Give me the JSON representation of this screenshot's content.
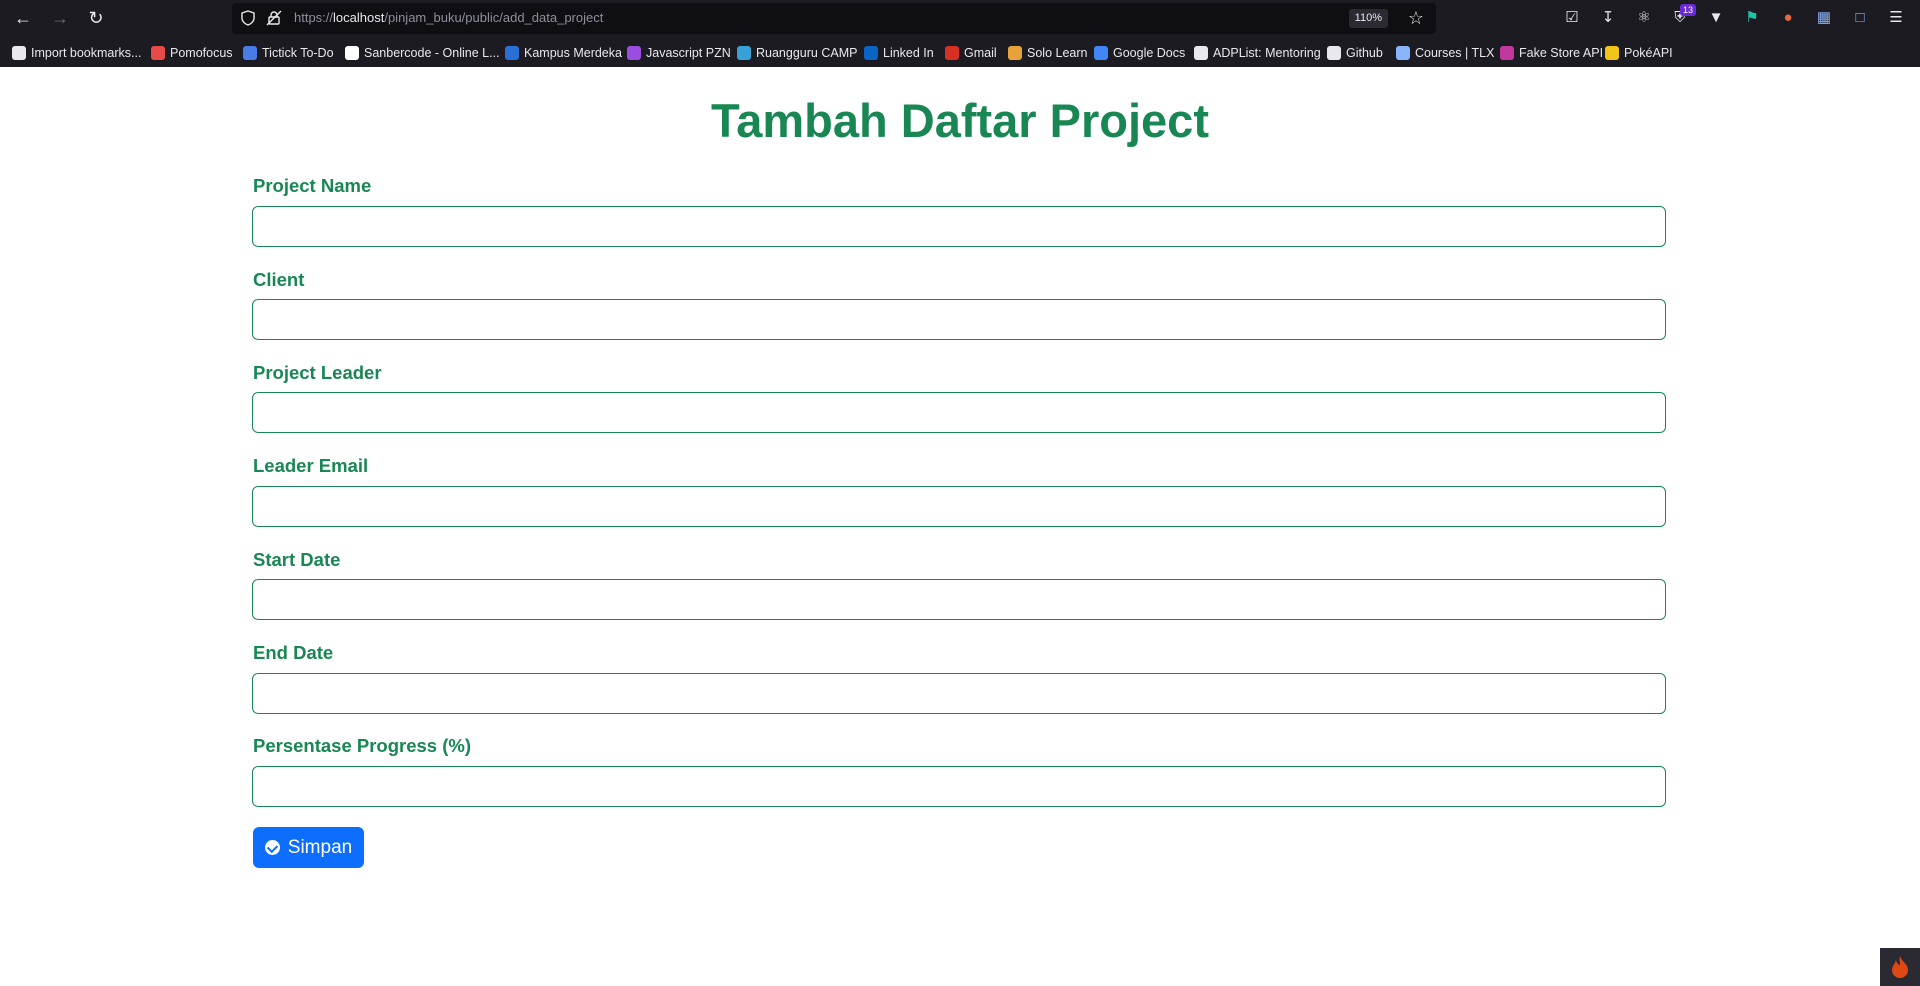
{
  "browser": {
    "url_host": "localhost",
    "url_path": "/pinjam_buku/public/add_data_project",
    "url_scheme": "https://",
    "zoom": "110%",
    "extension_badge_count": "13"
  },
  "bookmarks": [
    {
      "label": "Import bookmarks...",
      "icon": "import-icon",
      "color": "#e8e8ee"
    },
    {
      "label": "Pomofocus",
      "icon": "pomofocus-icon",
      "color": "#e84a4a"
    },
    {
      "label": "Tictick To-Do",
      "icon": "tick-icon",
      "color": "#4a7ce8"
    },
    {
      "label": "Sanbercode - Online L...",
      "icon": "sanbercode-icon",
      "color": "#ffffff"
    },
    {
      "label": "Kampus Merdeka",
      "icon": "kampus-icon",
      "color": "#2a6fd6"
    },
    {
      "label": "Javascript PZN",
      "icon": "pzn-icon",
      "color": "#9b4de0"
    },
    {
      "label": "Ruangguru CAMP",
      "icon": "ruangguru-icon",
      "color": "#3aa0d8"
    },
    {
      "label": "Linked In",
      "icon": "linkedin-icon",
      "color": "#0a66c2"
    },
    {
      "label": "Gmail",
      "icon": "gmail-icon",
      "color": "#d93025"
    },
    {
      "label": "Solo Learn",
      "icon": "sololearn-icon",
      "color": "#e8a23a"
    },
    {
      "label": "Google Docs",
      "icon": "docs-icon",
      "color": "#4285f4"
    },
    {
      "label": "ADPList: Mentoring",
      "icon": "adplist-icon",
      "color": "#e8e8ee"
    },
    {
      "label": "Github",
      "icon": "github-icon",
      "color": "#e8e8ee"
    },
    {
      "label": "Courses | TLX",
      "icon": "tlx-icon",
      "color": "#8ab4f8"
    },
    {
      "label": "Fake Store API",
      "icon": "fakestore-icon",
      "color": "#c2389e"
    },
    {
      "label": "PokéAPI",
      "icon": "pokeapi-icon",
      "color": "#f0c419"
    }
  ],
  "page": {
    "title": "Tambah Daftar Project",
    "fields": [
      {
        "label": "Project Name",
        "value": ""
      },
      {
        "label": "Client",
        "value": ""
      },
      {
        "label": "Project Leader",
        "value": ""
      },
      {
        "label": "Leader Email",
        "value": ""
      },
      {
        "label": "Start Date",
        "value": ""
      },
      {
        "label": "End Date",
        "value": ""
      },
      {
        "label": "Persentase Progress (%)",
        "value": ""
      }
    ],
    "save_label": "Simpan"
  },
  "colors": {
    "accent_green": "#198754",
    "button_blue": "#0d6efd",
    "chrome_bg": "#1c1b22"
  }
}
